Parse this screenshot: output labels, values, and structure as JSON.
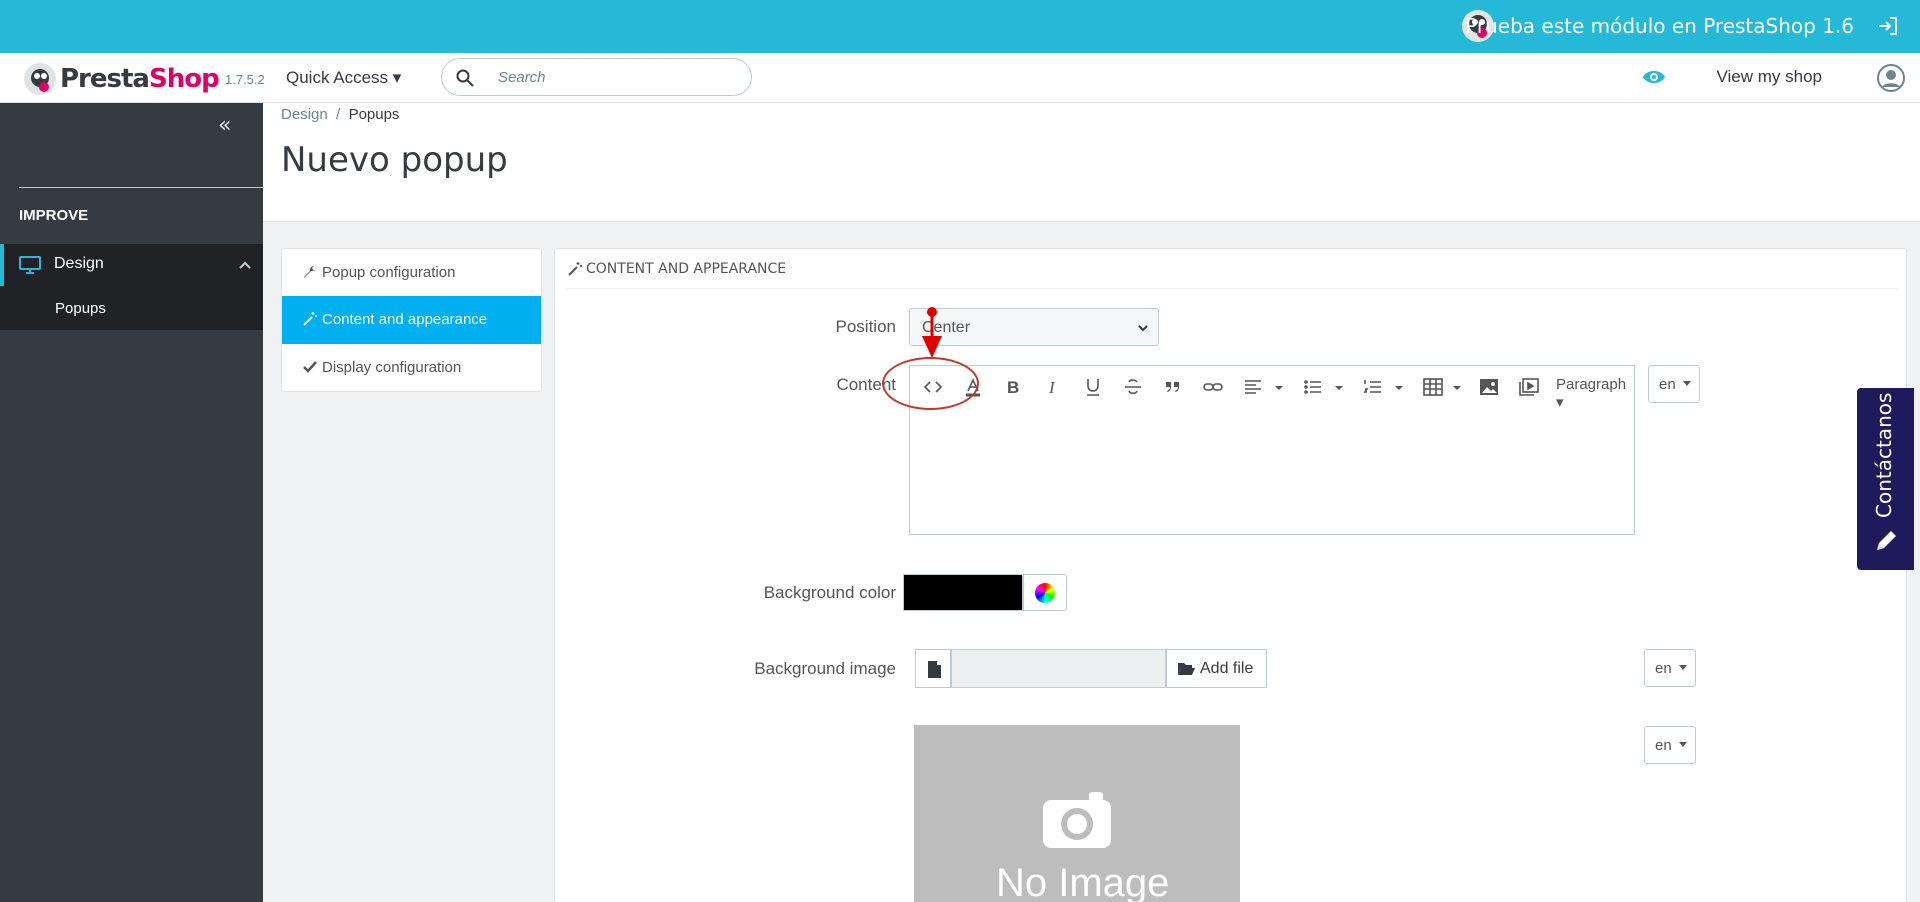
{
  "topbar": {
    "promo": "Prueba este módulo en PrestaShop 1.6"
  },
  "header": {
    "logo_part1": "Presta",
    "logo_part2": "Shop",
    "version": "1.7.5.2",
    "quick_access": "Quick Access",
    "search_placeholder": "Search",
    "view_shop": "View my shop"
  },
  "sidebar": {
    "section": "IMPROVE",
    "items": [
      {
        "label": "Design",
        "icon": "monitor-icon"
      },
      {
        "label": "Popups"
      }
    ]
  },
  "breadcrumb": {
    "parent": "Design",
    "separator": "/",
    "current": "Popups"
  },
  "page_title": "Nuevo popup",
  "tabs": [
    {
      "label": "Popup configuration",
      "icon": "wrench-icon"
    },
    {
      "label": "Content and appearance",
      "icon": "magic-wand-icon",
      "active": true
    },
    {
      "label": "Display configuration",
      "icon": "check-icon"
    }
  ],
  "panel": {
    "heading": "CONTENT AND APPEARANCE",
    "position_label": "Position",
    "position_value": "Center",
    "content_label": "Content",
    "paragraph": "Paragraph",
    "lang": "en",
    "bg_color_label": "Background color",
    "bg_color_value": "#000000",
    "bg_image_label": "Background image",
    "add_file": "Add file",
    "no_image": "No Image"
  },
  "contact_tab": "Contáctanos",
  "colors": {
    "topbar": "#25b9d7",
    "sidebar": "#363a41",
    "active_tab": "#00aff0",
    "brand_pink": "#df0067",
    "contact": "#1f1a5c"
  }
}
